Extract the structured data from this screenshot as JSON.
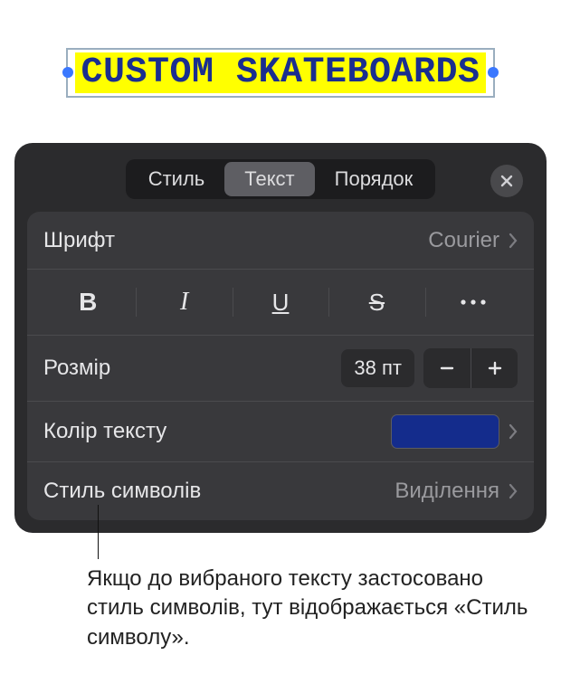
{
  "canvas": {
    "sample_text": "CUSTOM SKATEBOARDS",
    "highlight_color": "#ffff00",
    "text_color": "#1a2e8f"
  },
  "panel": {
    "tabs": {
      "style": "Стиль",
      "text": "Текст",
      "order": "Порядок",
      "active_index": 1
    },
    "font": {
      "label": "Шрифт",
      "value": "Courier"
    },
    "style_buttons": {
      "bold": "B",
      "italic": "I",
      "underline": "U",
      "strike": "S",
      "more": "···"
    },
    "size": {
      "label": "Розмір",
      "value": "38 пт"
    },
    "text_color": {
      "label": "Колір тексту",
      "swatch": "#142c8c"
    },
    "char_style": {
      "label": "Стиль символів",
      "value": "Виділення"
    }
  },
  "callout": {
    "text": "Якщо до вибраного тексту застосовано стиль символів, тут відображається «Стиль символу»."
  }
}
